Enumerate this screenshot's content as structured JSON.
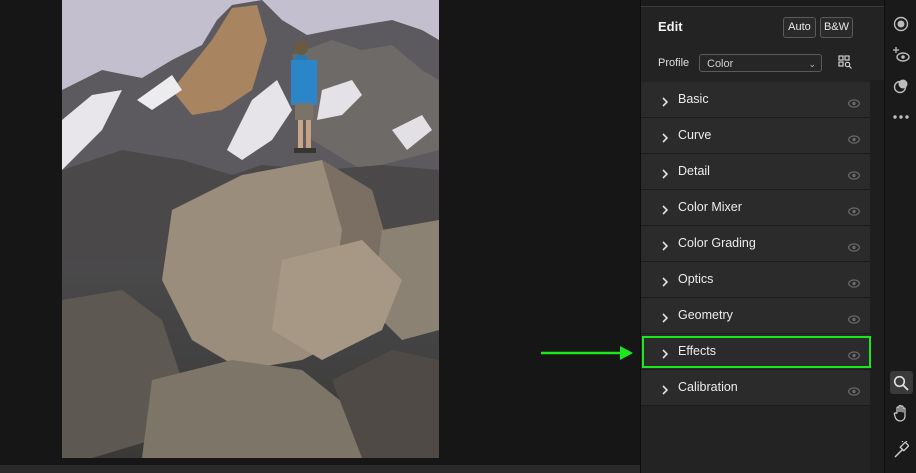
{
  "edit_panel": {
    "title": "Edit",
    "auto_label": "Auto",
    "bw_label": "B&W",
    "profile_label": "Profile",
    "profile_value": "Color",
    "sections": [
      {
        "label": "Basic"
      },
      {
        "label": "Curve"
      },
      {
        "label": "Detail"
      },
      {
        "label": "Color Mixer"
      },
      {
        "label": "Color Grading"
      },
      {
        "label": "Optics"
      },
      {
        "label": "Geometry"
      },
      {
        "label": "Effects"
      },
      {
        "label": "Calibration"
      }
    ]
  },
  "highlight_color": "#1ee61e",
  "toolstrip": {
    "icons": [
      "edit-icon",
      "healing-icon",
      "masking-icon",
      "more-icon",
      "zoom-icon",
      "hand-icon",
      "eyedropper-icon"
    ]
  }
}
